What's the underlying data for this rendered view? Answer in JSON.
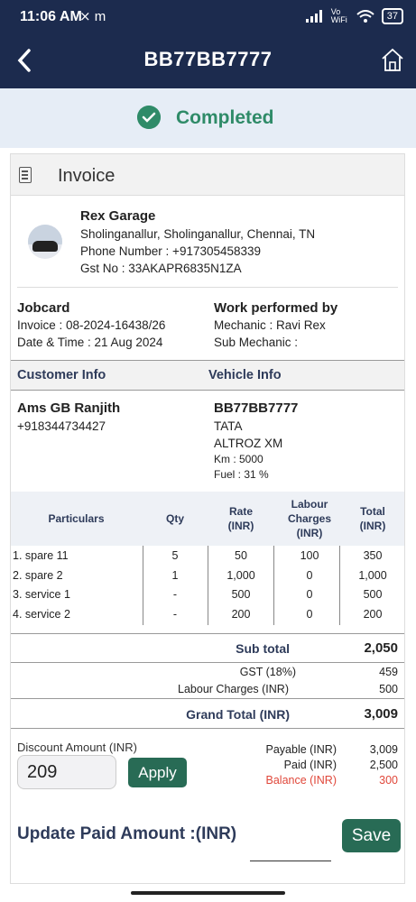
{
  "statusbar": {
    "time": "11:06 AM",
    "left_icons": "⨯ m",
    "network": "Vo WiFi",
    "battery": "37"
  },
  "appbar": {
    "title": "BB77BB7777"
  },
  "status": {
    "label": "Completed"
  },
  "invoice": {
    "header": "Invoice"
  },
  "garage": {
    "name": "Rex Garage",
    "address": "Sholinganallur, Sholinganallur, Chennai, TN",
    "phone": "Phone Number : +917305458339",
    "gst": "Gst No : 33AKAPR6835N1ZA"
  },
  "jobcard": {
    "title": "Jobcard",
    "invoice": "Invoice : 08-2024-16438/26",
    "datetime": "Date & Time : 21 Aug 2024"
  },
  "work": {
    "title": "Work performed by",
    "mechanic": "Mechanic : Ravi Rex",
    "sub_mechanic": "Sub Mechanic :"
  },
  "sections": {
    "customer": "Customer Info",
    "vehicle": "Vehicle Info"
  },
  "customer": {
    "name": "Ams GB Ranjith",
    "phone": "+918344734427"
  },
  "vehicle": {
    "reg": "BB77BB7777",
    "make": "TATA",
    "model": "ALTROZ XM",
    "km": "Km : 5000",
    "fuel": "Fuel : 31 %"
  },
  "table": {
    "headers": {
      "particulars": "Particulars",
      "qty": "Qty",
      "rate": "Rate\n(INR)",
      "labour": "Labour\nCharges\n(INR)",
      "total": "Total\n(INR)"
    },
    "rows": [
      {
        "item": "1. spare 11",
        "qty": "5",
        "rate": "50",
        "labour": "100",
        "total": "350"
      },
      {
        "item": "2. spare 2",
        "qty": "1",
        "rate": "1,000",
        "labour": "0",
        "total": "1,000"
      },
      {
        "item": "3. service 1",
        "qty": "-",
        "rate": "500",
        "labour": "0",
        "total": "500"
      },
      {
        "item": "4. service 2",
        "qty": "-",
        "rate": "200",
        "labour": "0",
        "total": "200"
      }
    ]
  },
  "totals": {
    "subtotal_label": "Sub total",
    "subtotal": "2,050",
    "gst_label": "GST (18%)",
    "gst": "459",
    "labour_label": "Labour Charges (INR)",
    "labour": "500",
    "grand_label": "Grand Total (INR)",
    "grand": "3,009"
  },
  "discount": {
    "label": "Discount Amount (INR)",
    "value": "209",
    "apply": "Apply"
  },
  "payment": {
    "payable_label": "Payable (INR)",
    "payable": "3,009",
    "paid_label": "Paid (INR)",
    "paid": "2,500",
    "balance_label": "Balance (INR)",
    "balance": "300",
    "balance_color": "#e0473a"
  },
  "update": {
    "label": "Update Paid Amount :(INR)",
    "save": "Save"
  },
  "colors": {
    "navy": "#1c2b4e",
    "green": "#2f8b68"
  }
}
